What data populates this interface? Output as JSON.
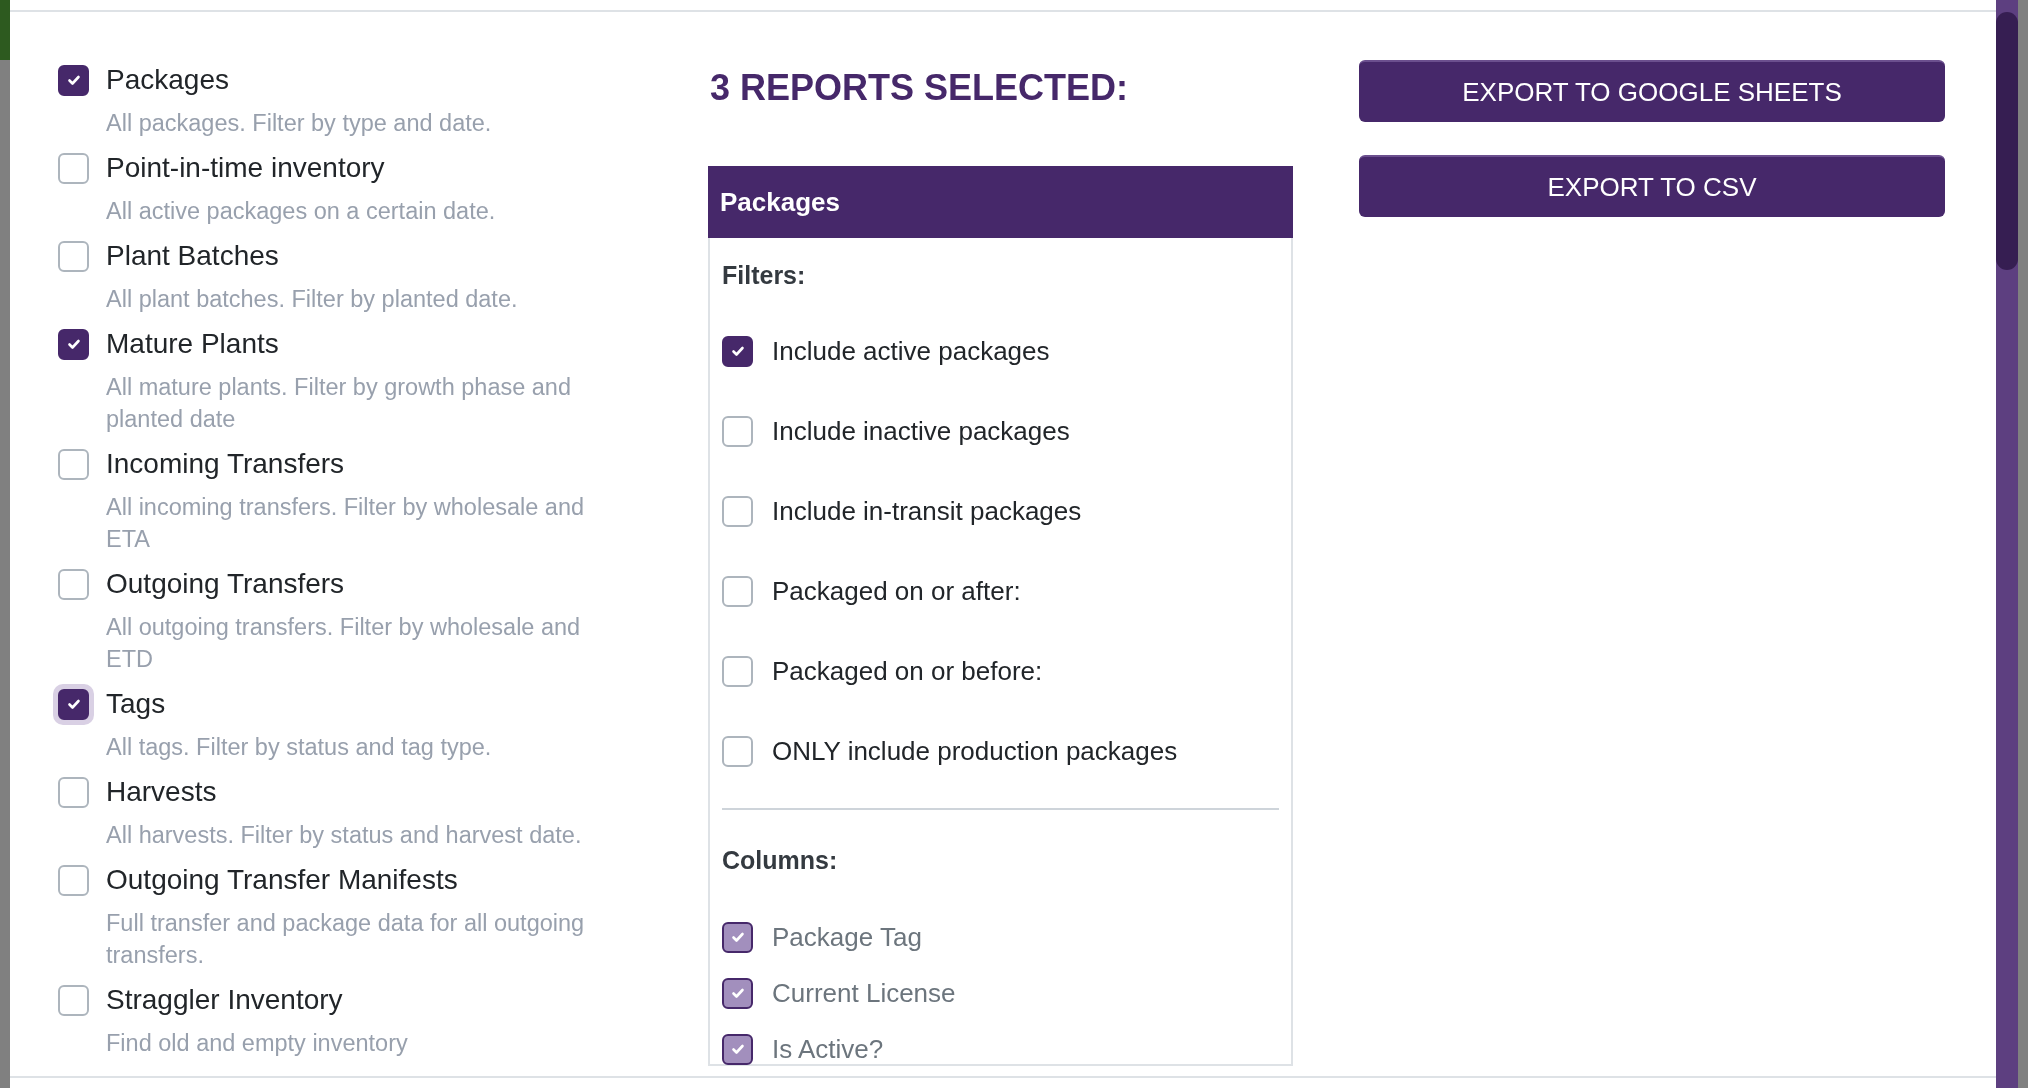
{
  "reports": [
    {
      "label": "Packages",
      "description": "All packages. Filter by type and date.",
      "checked": true,
      "focused": false
    },
    {
      "label": "Point-in-time inventory",
      "description": "All active packages on a certain date.",
      "checked": false,
      "focused": false
    },
    {
      "label": "Plant Batches",
      "description": "All plant batches. Filter by planted date.",
      "checked": false,
      "focused": false
    },
    {
      "label": "Mature Plants",
      "description": "All mature plants. Filter by growth phase and planted date",
      "checked": true,
      "focused": false
    },
    {
      "label": "Incoming Transfers",
      "description": "All incoming transfers. Filter by wholesale and ETA",
      "checked": false,
      "focused": false
    },
    {
      "label": "Outgoing Transfers",
      "description": "All outgoing transfers. Filter by wholesale and ETD",
      "checked": false,
      "focused": false
    },
    {
      "label": "Tags",
      "description": "All tags. Filter by status and tag type.",
      "checked": true,
      "focused": true
    },
    {
      "label": "Harvests",
      "description": "All harvests. Filter by status and harvest date.",
      "checked": false,
      "focused": false
    },
    {
      "label": "Outgoing Transfer Manifests",
      "description": "Full transfer and package data for all outgoing transfers.",
      "checked": false,
      "focused": false
    },
    {
      "label": "Straggler Inventory",
      "description": "Find old and empty inventory",
      "checked": false,
      "focused": false
    }
  ],
  "summary": {
    "title": "3 REPORTS SELECTED:"
  },
  "report_card": {
    "title": "Packages",
    "filters_label": "Filters:",
    "filters": [
      {
        "label": "Include active packages",
        "checked": true
      },
      {
        "label": "Include inactive packages",
        "checked": false
      },
      {
        "label": "Include in-transit packages",
        "checked": false
      },
      {
        "label": "Packaged on or after:",
        "checked": false
      },
      {
        "label": "Packaged on or before:",
        "checked": false
      },
      {
        "label": "ONLY include production packages",
        "checked": false
      }
    ],
    "columns_label": "Columns:",
    "columns": [
      {
        "label": "Package Tag",
        "checked": true,
        "disabled": true
      },
      {
        "label": "Current License",
        "checked": true,
        "disabled": true
      },
      {
        "label": "Is Active?",
        "checked": true,
        "disabled": true
      }
    ]
  },
  "buttons": [
    "EXPORT TO GOOGLE SHEETS",
    "EXPORT TO CSV"
  ]
}
